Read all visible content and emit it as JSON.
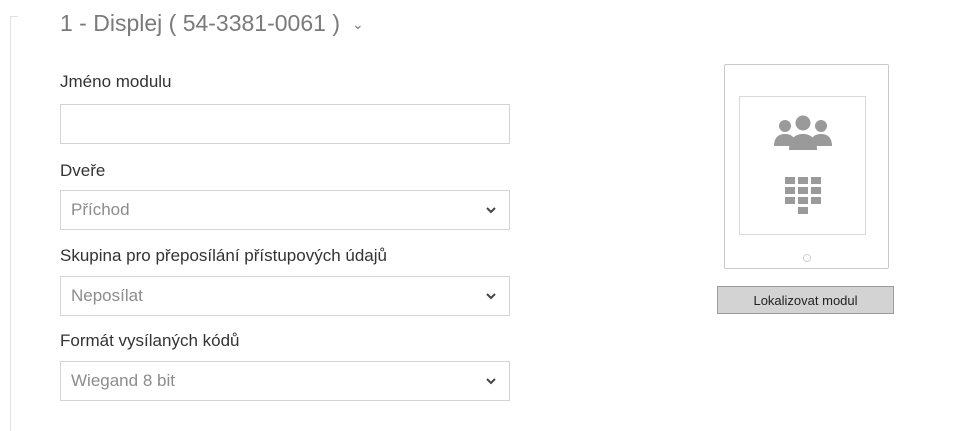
{
  "module": {
    "title": "1 - Displej ( 54-3381-0061 )"
  },
  "fields": {
    "module_name": {
      "label": "Jméno modulu",
      "value": ""
    },
    "door": {
      "label": "Dveře",
      "value": "Příchod"
    },
    "forward_group": {
      "label": "Skupina pro přeposílání přístupových údajů",
      "value": "Neposílat"
    },
    "code_format": {
      "label": "Formát vysílaných kódů",
      "value": "Wiegand 8 bit"
    }
  },
  "device_preview": {
    "icons": [
      "people-group-icon",
      "keypad-icon"
    ]
  },
  "buttons": {
    "locate": "Lokalizovat modul"
  },
  "colors": {
    "label_text": "#333333",
    "muted_text": "#8c8c8c",
    "border": "#d4d4d4",
    "button_bg": "#d3d3d3",
    "icon_gray": "#9a9a9a"
  }
}
